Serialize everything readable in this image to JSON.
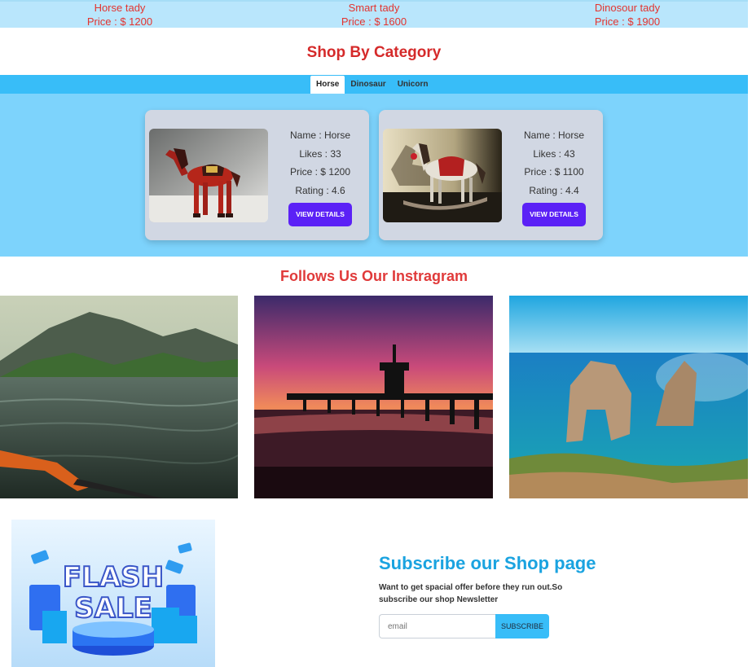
{
  "top_products": [
    {
      "name": "Horse tady",
      "price": "Price : $ 1200"
    },
    {
      "name": "Smart tady",
      "price": "Price : $ 1600"
    },
    {
      "name": "Dinosour tady",
      "price": "Price : $ 1900"
    }
  ],
  "category": {
    "title": "Shop By Category",
    "tabs": [
      "Horse",
      "Dinosaur",
      "Unicorn"
    ],
    "active_tab": "Horse",
    "cards": [
      {
        "name": "Name : Horse",
        "likes": "Likes : 33",
        "price": "Price : $ 1200",
        "rating": "Rating : 4.6",
        "button": "VIEW DETAILS"
      },
      {
        "name": "Name : Horse",
        "likes": "Likes : 43",
        "price": "Price : $ 1100",
        "rating": "Rating : 4.4",
        "button": "VIEW DETAILS"
      }
    ]
  },
  "instagram": {
    "title": "Follows Us Our Instragram"
  },
  "subscribe": {
    "title": "Subscribe our Shop page",
    "text": "Want to get spacial offer before they run out.So subscribe our shop Newsletter",
    "placeholder": "email",
    "button": "SUBSCRIBE"
  },
  "flash_banner": {
    "line1": "FLASH",
    "line2": "SALE"
  },
  "colors": {
    "accent_red": "#d52a2a",
    "sky": "#38bdf8",
    "panel": "#7dd3fc",
    "button_purple": "#5b21f6"
  }
}
